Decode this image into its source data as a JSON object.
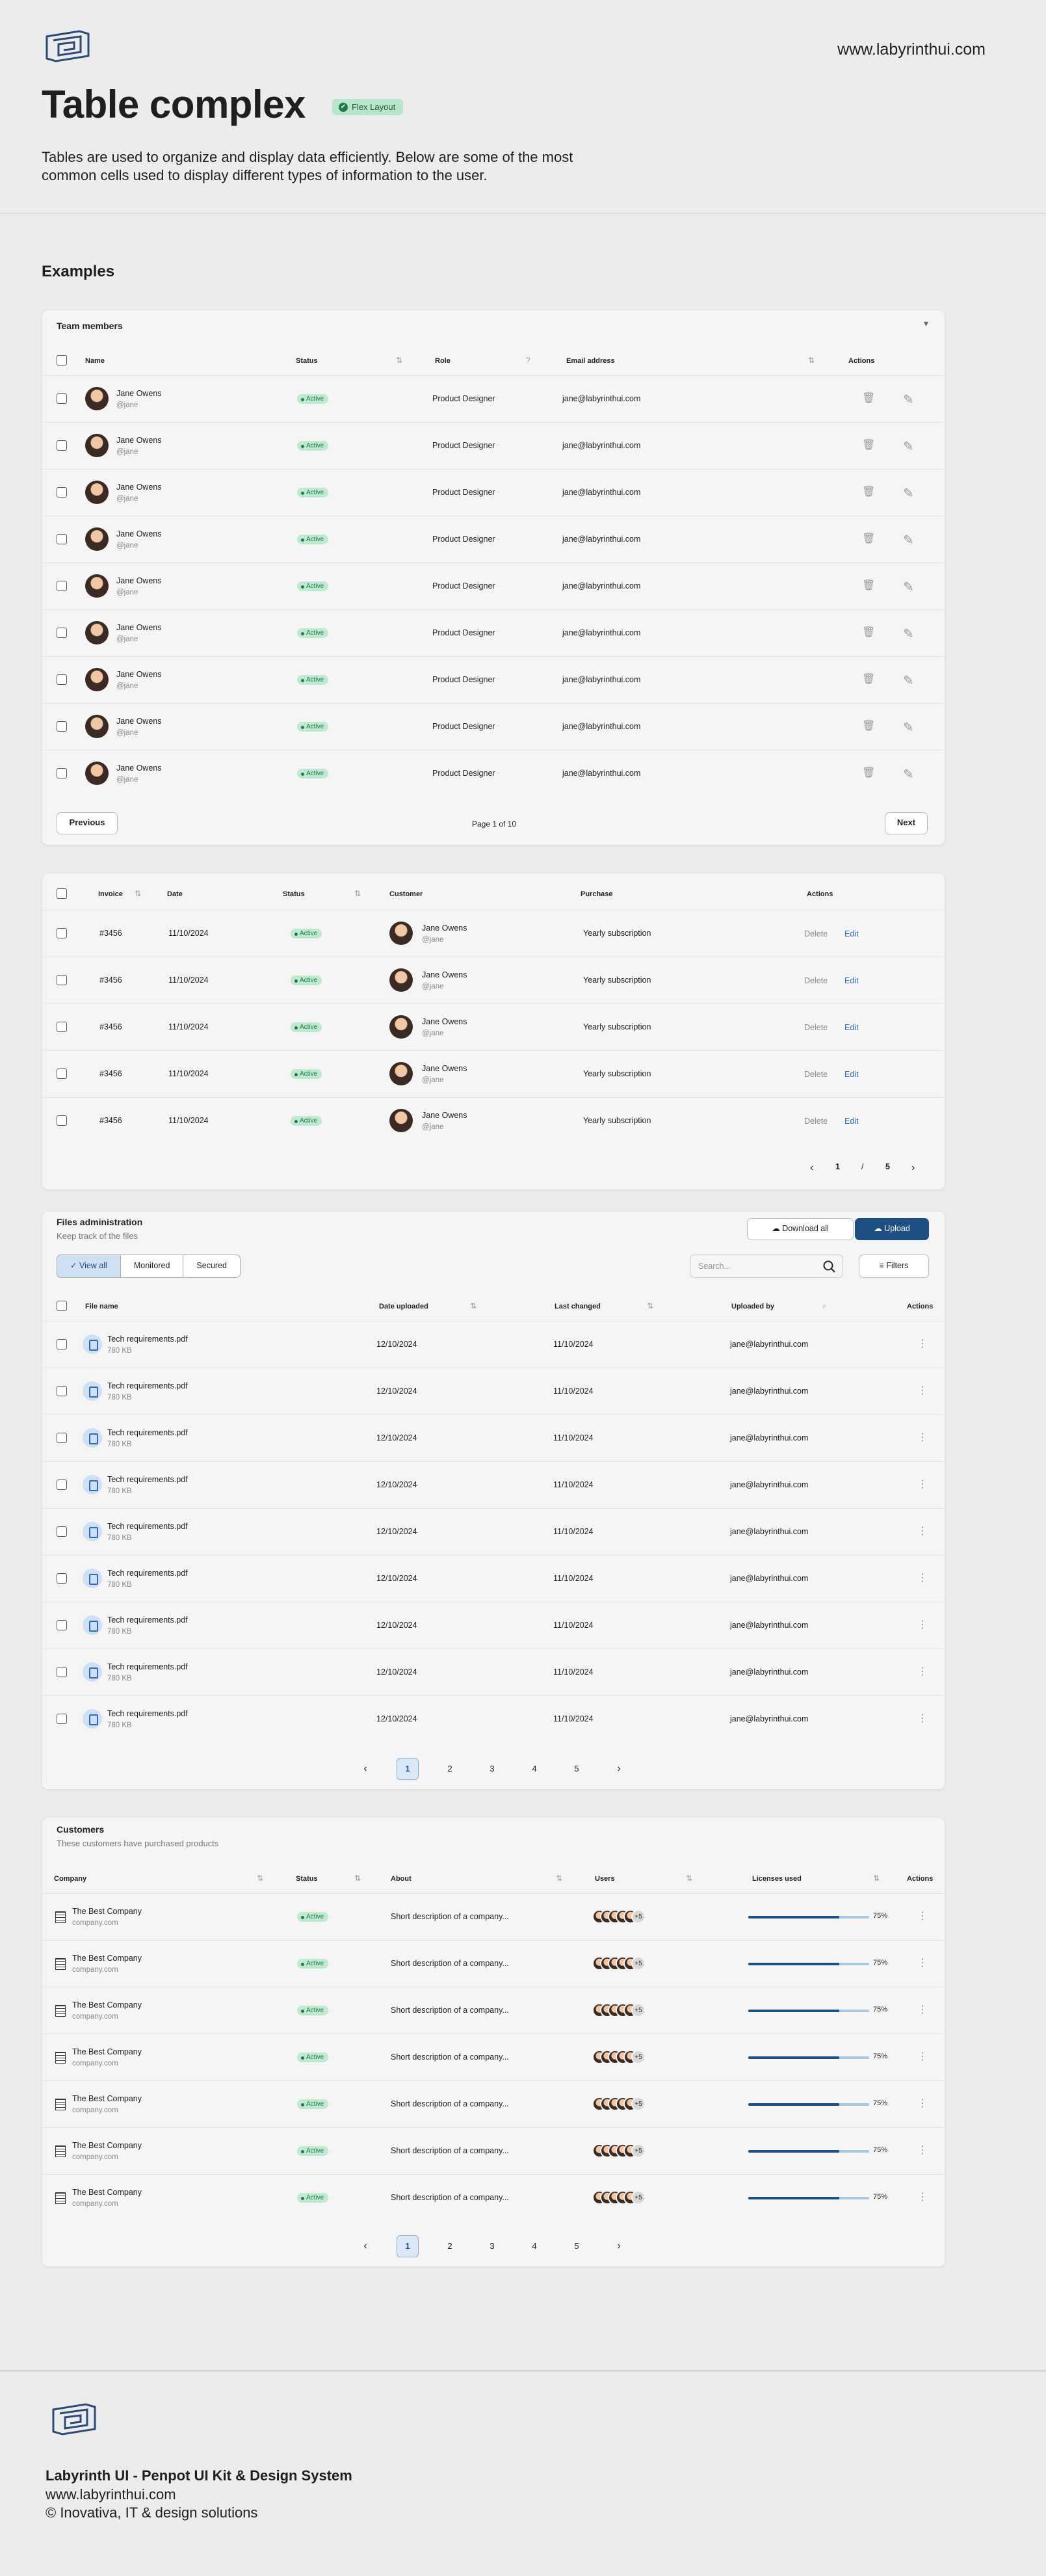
{
  "header": {
    "site_url": "www.labyrinthui.com",
    "title": "Table complex",
    "badge": "Flex Layout",
    "badge_check": "✔",
    "description": "Tables are used to organize and display data efficiently. Below are some of the most common cells used to display different types of information to the user."
  },
  "section_title": "Examples",
  "team": {
    "title": "Team members",
    "columns": [
      "Name",
      "Status",
      "Role",
      "Email address",
      "Actions"
    ],
    "rows": [
      {
        "name": "Jane Owens",
        "handle": "@jane",
        "status": "Active",
        "role": "Product Designer",
        "email": "jane@labyrinthui.com"
      },
      {
        "name": "Jane Owens",
        "handle": "@jane",
        "status": "Active",
        "role": "Product Designer",
        "email": "jane@labyrinthui.com"
      },
      {
        "name": "Jane Owens",
        "handle": "@jane",
        "status": "Active",
        "role": "Product Designer",
        "email": "jane@labyrinthui.com"
      },
      {
        "name": "Jane Owens",
        "handle": "@jane",
        "status": "Active",
        "role": "Product Designer",
        "email": "jane@labyrinthui.com"
      },
      {
        "name": "Jane Owens",
        "handle": "@jane",
        "status": "Active",
        "role": "Product Designer",
        "email": "jane@labyrinthui.com"
      },
      {
        "name": "Jane Owens",
        "handle": "@jane",
        "status": "Active",
        "role": "Product Designer",
        "email": "jane@labyrinthui.com"
      },
      {
        "name": "Jane Owens",
        "handle": "@jane",
        "status": "Active",
        "role": "Product Designer",
        "email": "jane@labyrinthui.com"
      },
      {
        "name": "Jane Owens",
        "handle": "@jane",
        "status": "Active",
        "role": "Product Designer",
        "email": "jane@labyrinthui.com"
      },
      {
        "name": "Jane Owens",
        "handle": "@jane",
        "status": "Active",
        "role": "Product Designer",
        "email": "jane@labyrinthui.com"
      }
    ],
    "prev": "Previous",
    "next": "Next",
    "page_info": "Page 1 of 10"
  },
  "invoices": {
    "columns": [
      "Invoice",
      "Date",
      "Status",
      "Customer",
      "Purchase",
      "Actions"
    ],
    "rows": [
      {
        "invoice": "#3456",
        "date": "11/10/2024",
        "status": "Active",
        "name": "Jane Owens",
        "handle": "@jane",
        "purchase": "Yearly subscription",
        "delete": "Delete",
        "edit": "Edit"
      },
      {
        "invoice": "#3456",
        "date": "11/10/2024",
        "status": "Active",
        "name": "Jane Owens",
        "handle": "@jane",
        "purchase": "Yearly subscription",
        "delete": "Delete",
        "edit": "Edit"
      },
      {
        "invoice": "#3456",
        "date": "11/10/2024",
        "status": "Active",
        "name": "Jane Owens",
        "handle": "@jane",
        "purchase": "Yearly subscription",
        "delete": "Delete",
        "edit": "Edit"
      },
      {
        "invoice": "#3456",
        "date": "11/10/2024",
        "status": "Active",
        "name": "Jane Owens",
        "handle": "@jane",
        "purchase": "Yearly subscription",
        "delete": "Delete",
        "edit": "Edit"
      },
      {
        "invoice": "#3456",
        "date": "11/10/2024",
        "status": "Active",
        "name": "Jane Owens",
        "handle": "@jane",
        "purchase": "Yearly subscription",
        "delete": "Delete",
        "edit": "Edit"
      }
    ],
    "pager": {
      "current": "1",
      "sep": "/",
      "total": "5"
    }
  },
  "files": {
    "title": "Files administration",
    "subtitle": "Keep track of the files",
    "download": "Download all",
    "upload": "Upload",
    "tabs": [
      "View all",
      "Monitored",
      "Secured"
    ],
    "search_placeholder": "Search...",
    "filters": "Filters",
    "columns": [
      "File name",
      "Date uploaded",
      "Last changed",
      "Uploaded by",
      "Actions"
    ],
    "rows": [
      {
        "file": "Tech requirements.pdf",
        "size": "780 KB",
        "uploaded": "12/10/2024",
        "changed": "11/10/2024",
        "by": "jane@labyrinthui.com"
      },
      {
        "file": "Tech requirements.pdf",
        "size": "780 KB",
        "uploaded": "12/10/2024",
        "changed": "11/10/2024",
        "by": "jane@labyrinthui.com"
      },
      {
        "file": "Tech requirements.pdf",
        "size": "780 KB",
        "uploaded": "12/10/2024",
        "changed": "11/10/2024",
        "by": "jane@labyrinthui.com"
      },
      {
        "file": "Tech requirements.pdf",
        "size": "780 KB",
        "uploaded": "12/10/2024",
        "changed": "11/10/2024",
        "by": "jane@labyrinthui.com"
      },
      {
        "file": "Tech requirements.pdf",
        "size": "780 KB",
        "uploaded": "12/10/2024",
        "changed": "11/10/2024",
        "by": "jane@labyrinthui.com"
      },
      {
        "file": "Tech requirements.pdf",
        "size": "780 KB",
        "uploaded": "12/10/2024",
        "changed": "11/10/2024",
        "by": "jane@labyrinthui.com"
      },
      {
        "file": "Tech requirements.pdf",
        "size": "780 KB",
        "uploaded": "12/10/2024",
        "changed": "11/10/2024",
        "by": "jane@labyrinthui.com"
      },
      {
        "file": "Tech requirements.pdf",
        "size": "780 KB",
        "uploaded": "12/10/2024",
        "changed": "11/10/2024",
        "by": "jane@labyrinthui.com"
      },
      {
        "file": "Tech requirements.pdf",
        "size": "780 KB",
        "uploaded": "12/10/2024",
        "changed": "11/10/2024",
        "by": "jane@labyrinthui.com"
      }
    ],
    "pages": [
      "1",
      "2",
      "3",
      "4",
      "5"
    ]
  },
  "customers": {
    "title": "Customers",
    "subtitle": "These customers have purchased products",
    "columns": [
      "Company",
      "Status",
      "About",
      "Users",
      "Licenses used",
      "Actions"
    ],
    "rows": [
      {
        "company": "The Best Company",
        "domain": "company.com",
        "status": "Active",
        "about": "Short description of a company...",
        "extra_users": "+5",
        "license": 0.75,
        "license_label": "75%"
      },
      {
        "company": "The Best Company",
        "domain": "company.com",
        "status": "Active",
        "about": "Short description of a company...",
        "extra_users": "+5",
        "license": 0.75,
        "license_label": "75%"
      },
      {
        "company": "The Best Company",
        "domain": "company.com",
        "status": "Active",
        "about": "Short description of a company...",
        "extra_users": "+5",
        "license": 0.75,
        "license_label": "75%"
      },
      {
        "company": "The Best Company",
        "domain": "company.com",
        "status": "Active",
        "about": "Short description of a company...",
        "extra_users": "+5",
        "license": 0.75,
        "license_label": "75%"
      },
      {
        "company": "The Best Company",
        "domain": "company.com",
        "status": "Active",
        "about": "Short description of a company...",
        "extra_users": "+5",
        "license": 0.75,
        "license_label": "75%"
      },
      {
        "company": "The Best Company",
        "domain": "company.com",
        "status": "Active",
        "about": "Short description of a company...",
        "extra_users": "+5",
        "license": 0.75,
        "license_label": "75%"
      },
      {
        "company": "The Best Company",
        "domain": "company.com",
        "status": "Active",
        "about": "Short description of a company...",
        "extra_users": "+5",
        "license": 0.75,
        "license_label": "75%"
      }
    ],
    "pages": [
      "1",
      "2",
      "3",
      "4",
      "5"
    ]
  },
  "footer": {
    "line1": "Labyrinth UI  - Penpot UI Kit & Design System",
    "line2": "www.labyrinthui.com",
    "line3": "© Inovativa, IT & design solutions"
  },
  "icons": {
    "prev": "‹",
    "next": "›",
    "kebab": "⋮",
    "sort": "⇅",
    "dropdown": "▾",
    "check": "✓",
    "trash": "🗑",
    "edit": "✎",
    "cloud": "☁",
    "funnel": "≡",
    "help": "?"
  },
  "colors": {
    "accent": "#1d4f85",
    "status_bg": "#bfe9d0",
    "status_fg": "#1f7a45",
    "link": "#2e6bbf"
  }
}
